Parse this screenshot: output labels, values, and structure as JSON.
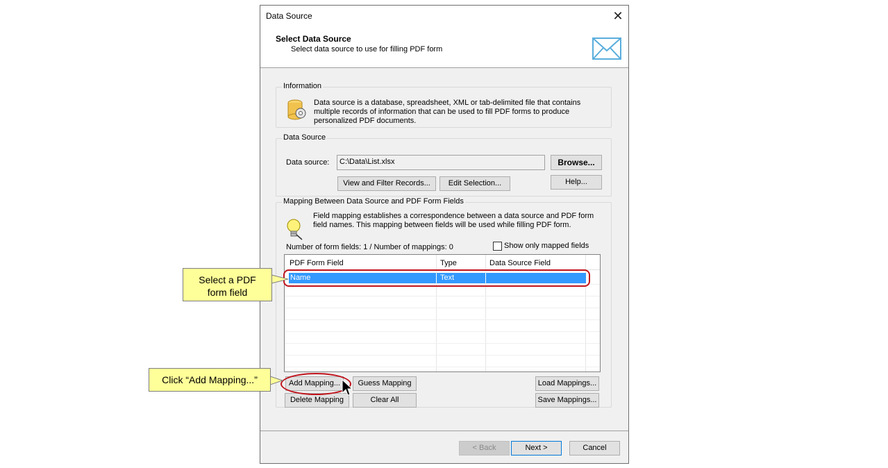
{
  "dialog": {
    "title": "Data Source",
    "header_title": "Select Data Source",
    "header_subtitle": "Select data source to use for filling PDF form"
  },
  "information": {
    "group_label": "Information",
    "text": "Data source is a database, spreadsheet, XML or tab-delimited file that contains multiple records of information that can be used to fill PDF forms to produce personalized PDF documents."
  },
  "data_source": {
    "group_label": "Data Source",
    "field_label": "Data source:",
    "field_value": "C:\\Data\\List.xlsx",
    "browse_label": "Browse...",
    "help_label": "Help...",
    "view_filter_label": "View and Filter Records...",
    "edit_selection_label": "Edit Selection..."
  },
  "mapping": {
    "group_label": "Mapping Between Data Source and PDF Form Fields",
    "text": "Field mapping establishes a correspondence between a data source and PDF form field names. This mapping between fields will be used while filling PDF form.",
    "count_text": "Number of form fields: 1 / Number of mappings: 0",
    "show_only_mapped_label": "Show only mapped fields",
    "show_only_mapped_checked": false,
    "columns": [
      "PDF Form Field",
      "Type",
      "Data Source Field"
    ],
    "rows": [
      {
        "field": "Name",
        "type": "Text",
        "source": ""
      }
    ],
    "buttons": {
      "add_mapping": "Add Mapping...",
      "guess_mapping": "Guess Mapping",
      "load_mappings": "Load Mappings...",
      "delete_mapping": "Delete Mapping",
      "clear_all": "Clear All",
      "save_mappings": "Save Mappings..."
    }
  },
  "footer": {
    "back_label": "< Back",
    "next_label": "Next >",
    "cancel_label": "Cancel"
  },
  "callouts": {
    "select_field_line1": "Select a PDF",
    "select_field_line2": "form field",
    "click_add": "Click “Add  Mapping...”"
  },
  "colors": {
    "selection": "#3399ff",
    "highlight_oval": "#c0121b",
    "callout_bg": "#ffff99",
    "default_button_border": "#0078d7"
  },
  "icons": {
    "close": "close-icon",
    "header": "envelope-icon",
    "information": "database-gear-icon",
    "mapping": "lightbulb-icon",
    "pointer": "mouse-pointer-icon"
  }
}
